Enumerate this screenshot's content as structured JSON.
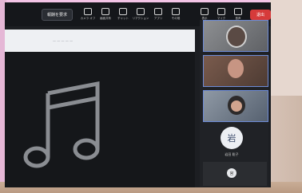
{
  "toolbar": {
    "quiz_button": "報酬を要求",
    "tools": [
      {
        "label": "カメラ オフ"
      },
      {
        "label": "画面共有"
      },
      {
        "label": "チャット"
      },
      {
        "label": "リアクション"
      },
      {
        "label": "アプリ"
      },
      {
        "label": "その他"
      }
    ],
    "right_tools": [
      {
        "label": "表示"
      },
      {
        "label": "マイク"
      },
      {
        "label": "音声"
      }
    ],
    "leave_label": "退出"
  },
  "content": {
    "url_text": "— — — — —"
  },
  "panel": {
    "avatar_initial": "岩",
    "avatar_name": "岩田 聡子",
    "mini_initial": "宮"
  },
  "colors": {
    "leave": "#d63a3a",
    "tile_border": "#6d8bd6"
  }
}
